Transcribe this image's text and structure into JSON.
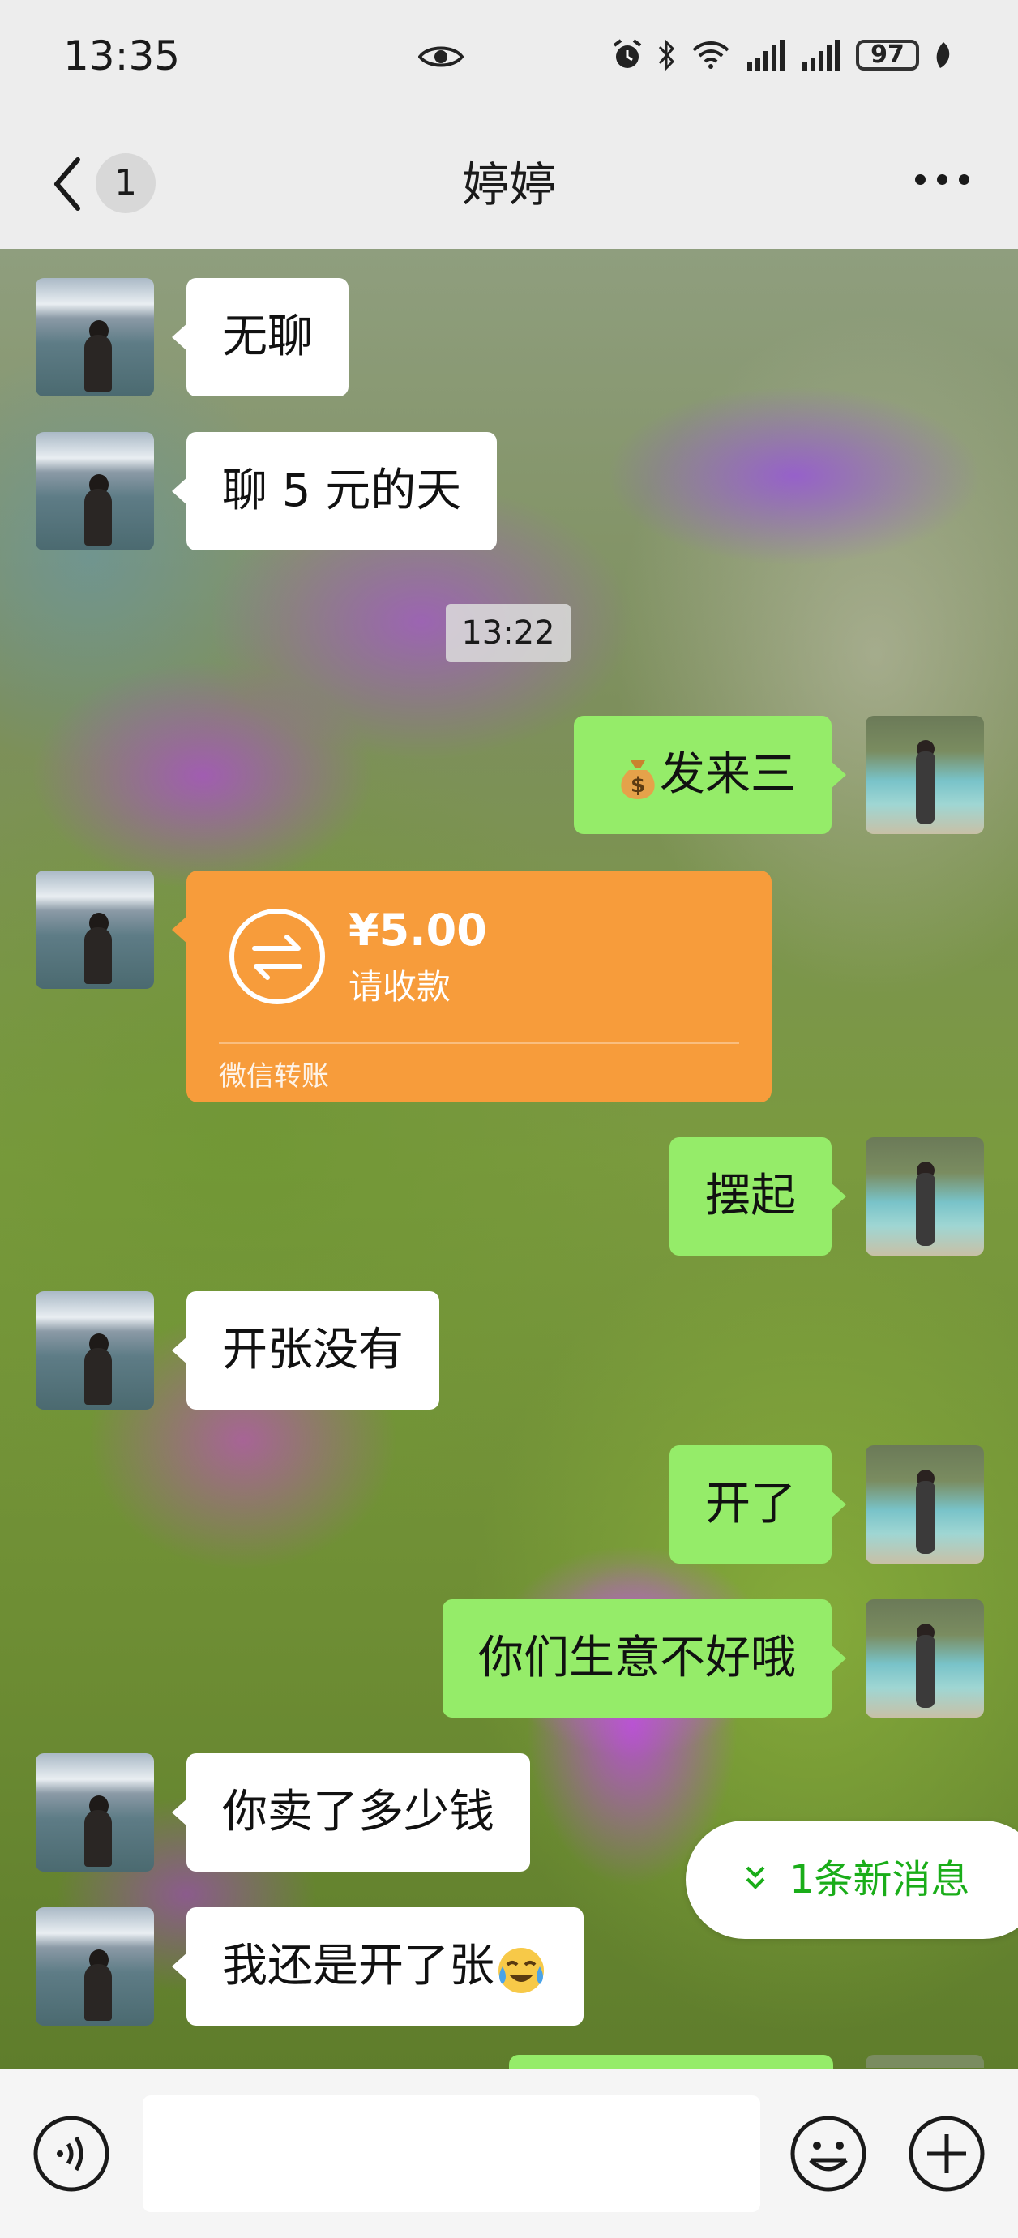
{
  "status_bar": {
    "time": "13:35",
    "battery": "97",
    "icons": [
      "eye-icon",
      "alarm-icon",
      "bluetooth-icon",
      "wifi-icon",
      "signal-icon",
      "signal-icon",
      "battery-icon",
      "leaf-icon"
    ]
  },
  "nav": {
    "back_icon": "chevron-left-icon",
    "unread_count": "1",
    "title": "婷婷",
    "more_icon": "more-dots-icon"
  },
  "messages": [
    {
      "side": "in",
      "text": "无聊"
    },
    {
      "side": "in",
      "text": "聊 5 元的天"
    },
    {
      "type": "timestamp",
      "text": "13:22"
    },
    {
      "side": "out",
      "emoji": "money-bag-emoji",
      "text": "发来三"
    },
    {
      "side": "in",
      "type": "transfer",
      "amount": "¥5.00",
      "status": "请收款",
      "footer": "微信转账"
    },
    {
      "side": "out",
      "text": "摆起"
    },
    {
      "side": "in",
      "text": "开张没有"
    },
    {
      "side": "out",
      "text": "开了"
    },
    {
      "side": "out",
      "text": "你们生意不好哦"
    },
    {
      "side": "in",
      "text": "你卖了多少钱"
    },
    {
      "side": "in",
      "text": "我还是开了张",
      "emoji": "crying-laughing-emoji"
    }
  ],
  "new_message_pill": {
    "icon": "double-chevron-down-icon",
    "text": "1条新消息"
  },
  "input_bar": {
    "voice_icon": "voice-icon",
    "input_value": "",
    "emoji_icon": "emoji-icon",
    "plus_icon": "plus-icon"
  }
}
